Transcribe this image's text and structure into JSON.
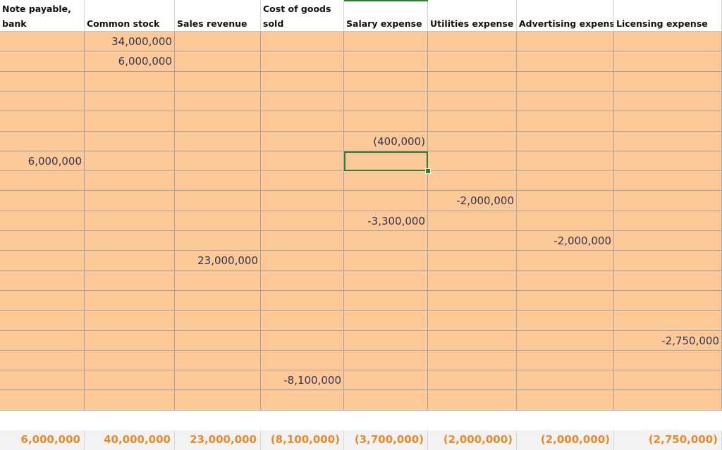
{
  "columns": [
    {
      "line1": "Note payable,",
      "line2": "bank"
    },
    {
      "line1": "",
      "line2": "Common stock"
    },
    {
      "line1": "",
      "line2": "Sales revenue"
    },
    {
      "line1": "Cost of goods",
      "line2": "sold"
    },
    {
      "line1": "",
      "line2": "Salary expense"
    },
    {
      "line1": "",
      "line2": "Utilities expense"
    },
    {
      "line1": "",
      "line2": "Advertising expense"
    },
    {
      "line1": "",
      "line2": "Licensing expense"
    }
  ],
  "rows": [
    [
      "",
      "34,000,000",
      "",
      "",
      "",
      "",
      "",
      ""
    ],
    [
      "",
      "6,000,000",
      "",
      "",
      "",
      "",
      "",
      ""
    ],
    [
      "",
      "",
      "",
      "",
      "",
      "",
      "",
      ""
    ],
    [
      "",
      "",
      "",
      "",
      "",
      "",
      "",
      ""
    ],
    [
      "",
      "",
      "",
      "",
      "",
      "",
      "",
      ""
    ],
    [
      "",
      "",
      "",
      "",
      "(400,000)",
      "",
      "",
      ""
    ],
    [
      "6,000,000",
      "",
      "",
      "",
      "",
      "",
      "",
      ""
    ],
    [
      "",
      "",
      "",
      "",
      "",
      "",
      "",
      ""
    ],
    [
      "",
      "",
      "",
      "",
      "",
      "-2,000,000",
      "",
      ""
    ],
    [
      "",
      "",
      "",
      "",
      "-3,300,000",
      "",
      "",
      ""
    ],
    [
      "",
      "",
      "",
      "",
      "",
      "",
      "-2,000,000",
      ""
    ],
    [
      "",
      "",
      "23,000,000",
      "",
      "",
      "",
      "",
      ""
    ],
    [
      "",
      "",
      "",
      "",
      "",
      "",
      "",
      ""
    ],
    [
      "",
      "",
      "",
      "",
      "",
      "",
      "",
      ""
    ],
    [
      "",
      "",
      "",
      "",
      "",
      "",
      "",
      ""
    ],
    [
      "",
      "",
      "",
      "",
      "",
      "",
      "",
      "-2,750,000"
    ],
    [
      "",
      "",
      "",
      "",
      "",
      "",
      "",
      ""
    ],
    [
      "",
      "",
      "",
      "-8,100,000",
      "",
      "",
      "",
      ""
    ],
    [
      "",
      "",
      "",
      "",
      "",
      "",
      "",
      ""
    ]
  ],
  "totals": [
    "6,000,000",
    "40,000,000",
    "23,000,000",
    "(8,100,000)",
    "(3,700,000)",
    "(2,000,000)",
    "(2,000,000)",
    "(2,750,000)"
  ],
  "selection": {
    "row": 6,
    "col": 4
  },
  "colors": {
    "cell_fill": "#fdc998",
    "total_text": "#e8892e",
    "selection": "#2e7d32"
  }
}
